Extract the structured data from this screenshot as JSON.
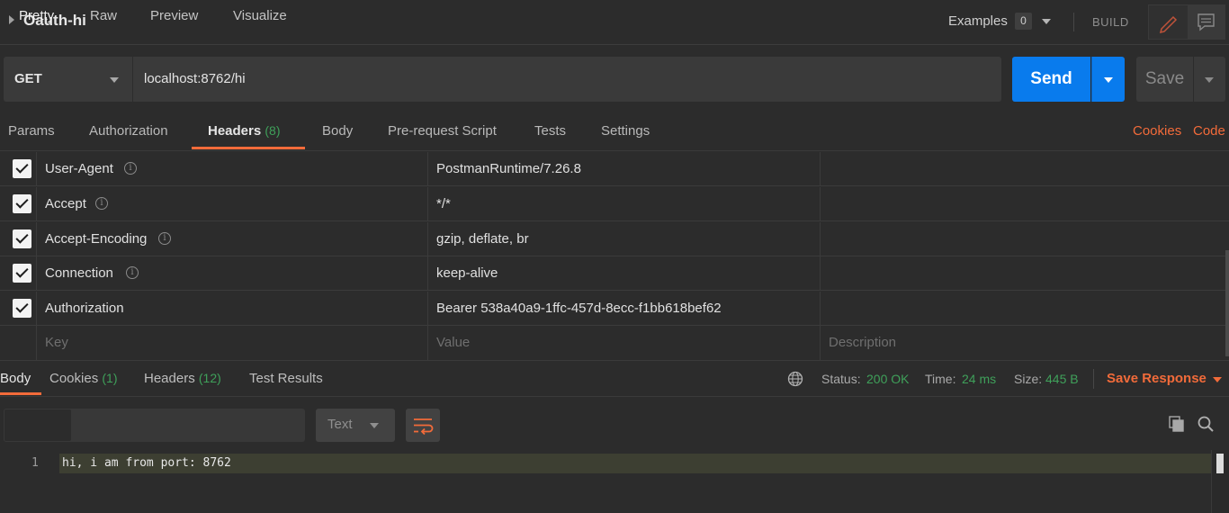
{
  "title_bar": {
    "request_name": "Oauth-hi",
    "examples_label": "Examples",
    "examples_count": "0",
    "build_label": "BUILD"
  },
  "url_bar": {
    "method": "GET",
    "url": "localhost:8762/hi",
    "send_label": "Send",
    "save_label": "Save"
  },
  "request_tabs": {
    "params": "Params",
    "authorization": "Authorization",
    "headers": "Headers",
    "headers_count": "(8)",
    "body": "Body",
    "prerequest": "Pre-request Script",
    "tests": "Tests",
    "settings": "Settings",
    "cookies": "Cookies",
    "code": "Code"
  },
  "headers": {
    "rows": [
      {
        "key": "User-Agent",
        "value": "PostmanRuntime/7.26.8",
        "checked": true,
        "info": true
      },
      {
        "key": "Accept",
        "value": "*/*",
        "checked": true,
        "info": true
      },
      {
        "key": "Accept-Encoding",
        "value": "gzip, deflate, br",
        "checked": true,
        "info": true
      },
      {
        "key": "Connection",
        "value": "keep-alive",
        "checked": true,
        "info": true
      },
      {
        "key": "Authorization",
        "value": "Bearer 538a40a9-1ffc-457d-8ecc-f1bb618bef62",
        "checked": true,
        "info": false
      }
    ],
    "placeholder": {
      "key": "Key",
      "value": "Value",
      "description": "Description"
    }
  },
  "response": {
    "tabs": {
      "body": "Body",
      "cookies": "Cookies",
      "cookies_count": "(1)",
      "headers": "Headers",
      "headers_count": "(12)",
      "test_results": "Test Results"
    },
    "status_label": "Status:",
    "status_value": "200 OK",
    "time_label": "Time:",
    "time_value": "24 ms",
    "size_label": "Size:",
    "size_value": "445 B",
    "save_response": "Save Response",
    "view_modes": {
      "pretty": "Pretty",
      "raw": "Raw",
      "preview": "Preview",
      "visualize": "Visualize"
    },
    "format": "Text",
    "body_lines": [
      {
        "num": "1",
        "text": "hi, i am from port: 8762"
      }
    ]
  },
  "colors": {
    "accent_orange": "#f26b3a",
    "send_blue": "#097bed",
    "status_green": "#3fa05a",
    "background": "#2c2c2c"
  },
  "icons": {
    "title_caret": "caret-right-icon",
    "pencil": "pencil-icon",
    "comment": "comment-icon",
    "globe": "globe-icon",
    "wrap": "wrap-lines-icon",
    "copy": "copy-icon",
    "search": "search-icon",
    "info": "info-icon",
    "checkbox": "checkbox-checked-icon"
  }
}
